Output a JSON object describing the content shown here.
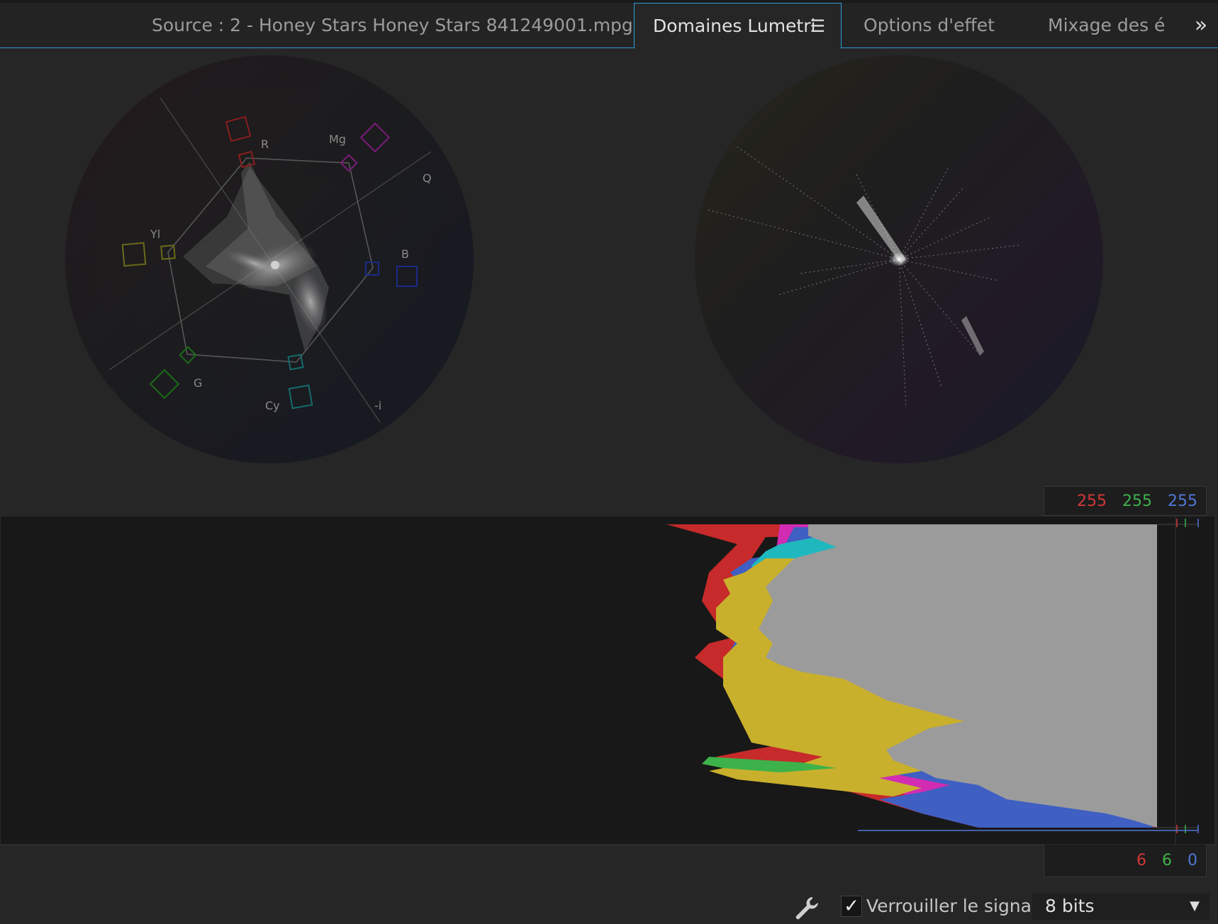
{
  "tabs": [
    {
      "label": "Source : 2 - Honey Stars Honey Stars 841249001.mpg",
      "active": false
    },
    {
      "label": "Domaines Lumetri",
      "active": true
    },
    {
      "label": "Options d'effet",
      "active": false
    },
    {
      "label": "Mixage des é",
      "active": false
    }
  ],
  "vectorscope": {
    "targets": [
      "R",
      "Mg",
      "B",
      "Cy",
      "G",
      "Yl"
    ],
    "axes": [
      "Q",
      "-i"
    ]
  },
  "waveform": {
    "top_values": {
      "r": "255",
      "g": "255",
      "b": "255"
    },
    "bottom_values": {
      "r": "6",
      "g": "6",
      "b": "0"
    }
  },
  "controls": {
    "lock_signal_label": "Verrouiller le signal",
    "lock_signal_checked": true,
    "bit_depth": "8 bits"
  },
  "icons": {
    "panel_menu": "hamburger-icon",
    "overflow": "double-chevron-right-icon",
    "settings": "wrench-icon",
    "dropdown": "triangle-down-icon"
  },
  "colors": {
    "accent": "#2f9bd6",
    "red": "#d43838",
    "green": "#3db24a",
    "blue": "#4f78d6",
    "cyan": "#1db8b8",
    "magenta": "#d02cb4",
    "yellow": "#c9b02c"
  }
}
